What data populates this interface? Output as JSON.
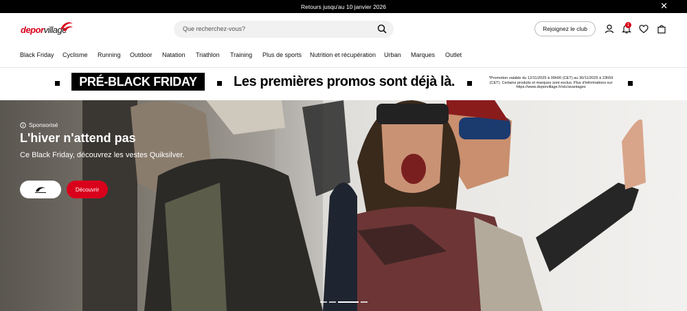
{
  "announcement": {
    "text": "Retours jusqu'au 10 janvier 2026",
    "close_icon": "close-icon"
  },
  "header": {
    "logo": {
      "part1": "depor",
      "part2": "village"
    },
    "search": {
      "placeholder": "Que recherchez-vous?"
    },
    "club_button": "Rejoignez le club",
    "notification_count": "1",
    "icons": [
      "user-icon",
      "bell-icon",
      "heart-icon",
      "bag-icon"
    ]
  },
  "nav": {
    "items": [
      "Black Friday",
      "Cyclisme",
      "Running",
      "Outdoor",
      "Natation",
      "Triathlon",
      "Training",
      "Plus de sports",
      "Nutrition et récupération",
      "Urban",
      "Marques",
      "Outlet"
    ]
  },
  "promo": {
    "label": "PRÉ-BLACK FRIDAY",
    "headline": "Les premières promos sont déjà là.",
    "fine_print": "*Promotion valable du 12/11/2025 à 00h00 (CET) au 30/11/2025 à 23h59 (CET). Certains produits et marques sont exclus. Plus d'informations sur https://www.deporvillage.fr/stc/avantages"
  },
  "hero": {
    "sponsor": "Sponsorisé",
    "title": "L'hiver n'attend pas",
    "subtitle": "Ce Black Friday, découvrez les vestes Quiksilver.",
    "cta": "Découvrir",
    "slides_total": 4,
    "slide_active": 3
  },
  "colors": {
    "accent": "#d9001b",
    "announce_bg": "#000000"
  }
}
